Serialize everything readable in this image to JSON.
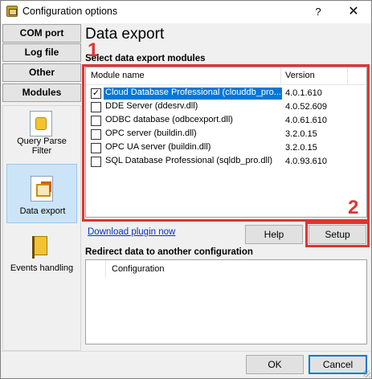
{
  "window": {
    "title": "Configuration options",
    "help_glyph": "?",
    "close_glyph": "✕"
  },
  "nav": {
    "tabs": [
      "COM port",
      "Log file",
      "Other",
      "Modules"
    ],
    "items": [
      {
        "label": "Query Parse Filter",
        "icon": "puzzle-document-icon"
      },
      {
        "label": "Data export",
        "icon": "export-document-icon",
        "selected": true
      },
      {
        "label": "Events handling",
        "icon": "flag-icon"
      }
    ]
  },
  "main": {
    "title": "Data export",
    "modules_label": "Select data export modules",
    "columns": {
      "name": "Module name",
      "version": "Version"
    },
    "modules": [
      {
        "checked": true,
        "name": "Cloud Database Professional (clouddb_pro....",
        "version": "4.0.1.610",
        "selected": true
      },
      {
        "checked": false,
        "name": "DDE Server (ddesrv.dll)",
        "version": "4.0.52.609"
      },
      {
        "checked": false,
        "name": "ODBC database (odbcexport.dll)",
        "version": "4.0.61.610"
      },
      {
        "checked": false,
        "name": "OPC server (buildin.dll)",
        "version": "3.2.0.15"
      },
      {
        "checked": false,
        "name": "OPC UA server (buildin.dll)",
        "version": "3.2.0.15"
      },
      {
        "checked": false,
        "name": "SQL Database Professional (sqldb_pro.dll)",
        "version": "4.0.93.610"
      }
    ],
    "download_link": "Download plugin now",
    "help_button": "Help",
    "setup_button": "Setup",
    "redirect_label": "Redirect data to another configuration",
    "redirect_column": "Configuration"
  },
  "annotations": {
    "marker_1": "1",
    "marker_2": "2",
    "color": "#e23232"
  },
  "footer": {
    "ok_button": "OK",
    "cancel_button": "Cancel"
  },
  "colors": {
    "selection": "#0078d7",
    "link": "#0033cc",
    "nav_selected": "#cce4f7"
  }
}
